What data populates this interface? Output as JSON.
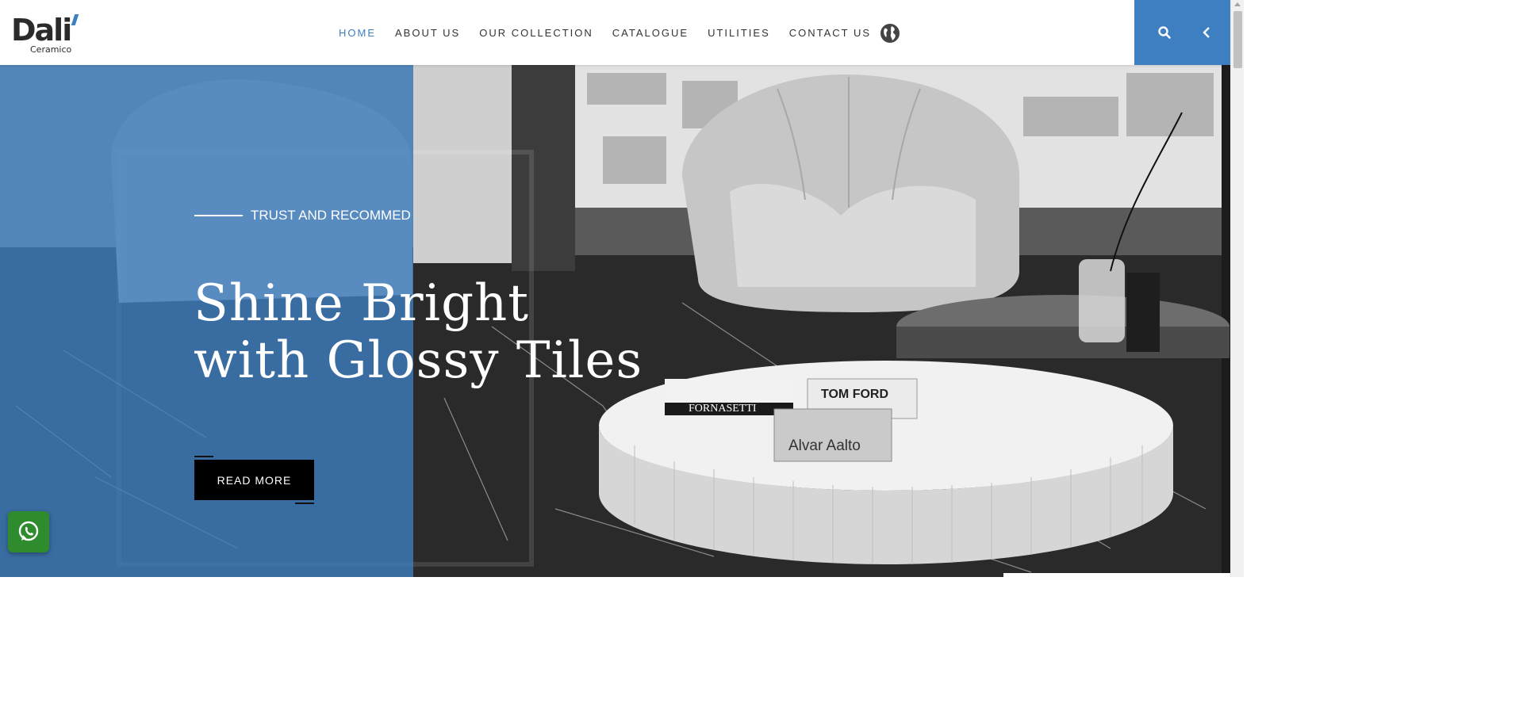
{
  "brand": {
    "name": "Dali",
    "sub": "Ceramico"
  },
  "nav": {
    "items": [
      "HOME",
      "ABOUT US",
      "OUR COLLECTION",
      "CATALOGUE",
      "UTILITIES",
      "CONTACT US"
    ],
    "active_index": 0,
    "globe_icon": "globe-icon"
  },
  "header_actions": {
    "search_icon": "search-icon",
    "toggle_icon": "chevron-left-icon"
  },
  "hero": {
    "eyebrow": "TRUST AND RECOMMED",
    "headline_line1": "Shine Bright",
    "headline_line2": "with Glossy Tiles",
    "cta": "READ MORE",
    "book_titles": [
      "FORNASETTI",
      "TOM FORD",
      "Alvar Aalto"
    ]
  },
  "floating": {
    "whatsapp_icon": "whatsapp-icon"
  },
  "colors": {
    "accent": "#3d7fc1",
    "button": "#000000",
    "whatsapp": "#2e8b2e"
  }
}
